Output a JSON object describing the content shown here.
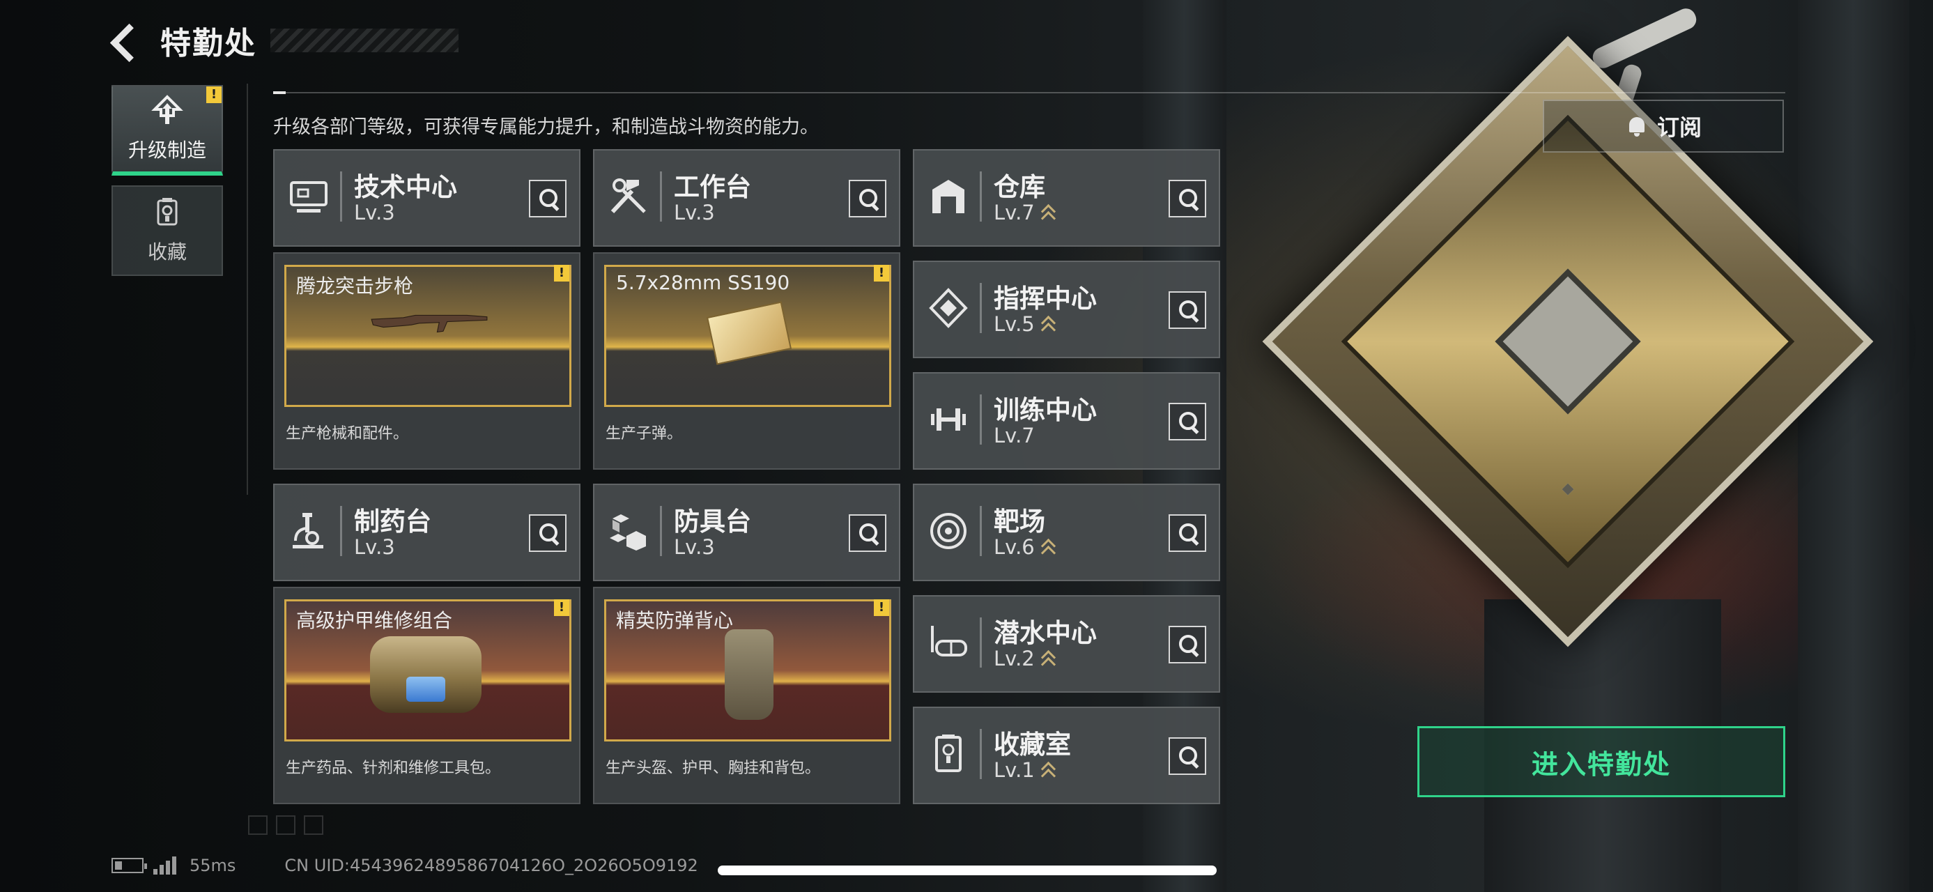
{
  "header": {
    "title": "特勤处"
  },
  "nav": {
    "items": [
      {
        "label": "升级制造",
        "active": true,
        "icon": "upgrade-icon",
        "badge": "!"
      },
      {
        "label": "收藏",
        "active": false,
        "icon": "collection-icon"
      }
    ]
  },
  "hint": "升级各部门等级，可获得专属能力提升，和制造战斗物资的能力。",
  "subscribe": {
    "label": "订阅",
    "icon": "bell-icon"
  },
  "departments": {
    "tech_center": {
      "name": "技术中心",
      "level": "Lv.3",
      "icon": "computer-icon",
      "product": {
        "title": "腾龙突击步枪",
        "desc": "生产枪械和配件。",
        "badge": "!"
      }
    },
    "workbench": {
      "name": "工作台",
      "level": "Lv.3",
      "icon": "hammer-wrench-icon",
      "product": {
        "title": "5.7x28mm SS190",
        "desc": "生产子弹。",
        "badge": "!"
      }
    },
    "pharmacy": {
      "name": "制药台",
      "level": "Lv.3",
      "icon": "microscope-icon",
      "product": {
        "title": "高级护甲维修组合",
        "desc": "生产药品、针剂和维修工具包。",
        "badge": "!"
      }
    },
    "armor_bench": {
      "name": "防具台",
      "level": "Lv.3",
      "icon": "cubes-icon",
      "product": {
        "title": "精英防弹背心",
        "desc": "生产头盔、护甲、胸挂和背包。",
        "badge": "!"
      }
    },
    "warehouse": {
      "name": "仓库",
      "level": "Lv.7",
      "icon": "warehouse-icon"
    },
    "command_center": {
      "name": "指挥中心",
      "level": "Lv.5",
      "icon": "diamond-target-icon"
    },
    "training_center": {
      "name": "训练中心",
      "level": "Lv.7",
      "icon": "dumbbell-icon"
    },
    "shooting_range": {
      "name": "靶场",
      "level": "Lv.6",
      "icon": "target-icon"
    },
    "diving_center": {
      "name": "潜水中心",
      "level": "Lv.2",
      "icon": "diving-mask-icon"
    },
    "collection_room": {
      "name": "收藏室",
      "level": "Lv.1",
      "icon": "trophy-icon"
    }
  },
  "enter_button": {
    "label": "进入特勤处"
  },
  "footer": {
    "ping": "55ms",
    "uid": "CN UID:4543962489586704126O_2O26O5O9192"
  },
  "colors": {
    "accent": "#2fd38a",
    "badge": "#f3c93a",
    "gold": "#d1a94a"
  }
}
